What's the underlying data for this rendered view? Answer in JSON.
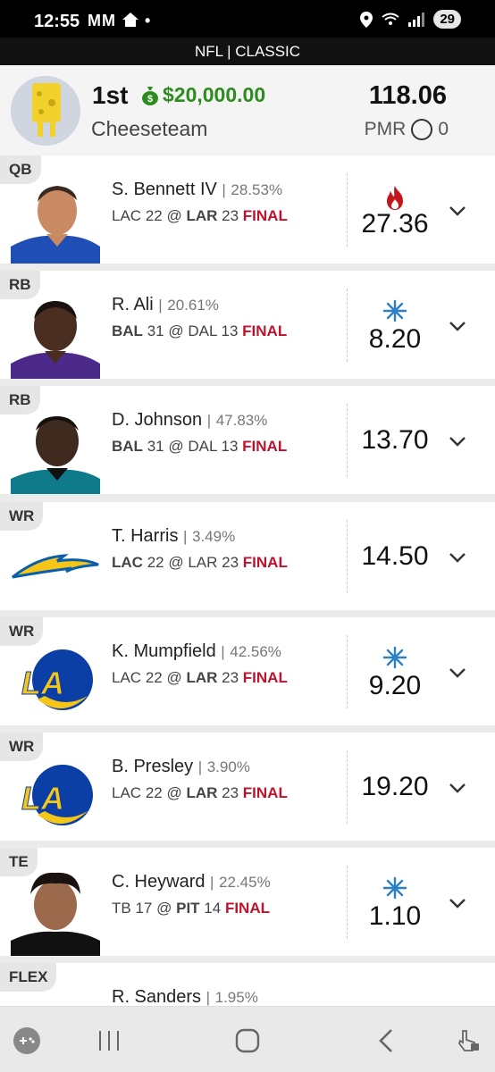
{
  "status_bar": {
    "time": "12:55",
    "left_icons": "MM",
    "battery": "29"
  },
  "header": {
    "title": "NFL | CLASSIC"
  },
  "summary": {
    "rank": "1st",
    "prize": "$20,000.00",
    "team_name": "Cheeseteam",
    "total_points": "118.06",
    "pmr_label": "PMR",
    "pmr_value": "0"
  },
  "players": [
    {
      "pos": "QB",
      "name": "S. Bennett IV",
      "pct": "28.53%",
      "away": "LAC",
      "away_score": "22",
      "home": "LAR",
      "home_score": "23",
      "bold": "home",
      "status": "FINAL",
      "points": "27.36",
      "indicator": "fire-icon",
      "thumb": "player-photo-ram"
    },
    {
      "pos": "RB",
      "name": "R. Ali",
      "pct": "20.61%",
      "away": "BAL",
      "away_score": "31",
      "home": "DAL",
      "home_score": "13",
      "bold": "away",
      "status": "FINAL",
      "points": "8.20",
      "indicator": "snowflake-icon",
      "thumb": "player-photo-raven"
    },
    {
      "pos": "RB",
      "name": "D. Johnson",
      "pct": "47.83%",
      "away": "BAL",
      "away_score": "31",
      "home": "DAL",
      "home_score": "13",
      "bold": "away",
      "status": "FINAL",
      "points": "13.70",
      "indicator": "",
      "thumb": "player-photo-jaguar"
    },
    {
      "pos": "WR",
      "name": "T. Harris",
      "pct": "3.49%",
      "away": "LAC",
      "away_score": "22",
      "home": "LAR",
      "home_score": "23",
      "bold": "away",
      "status": "FINAL",
      "points": "14.50",
      "indicator": "",
      "thumb": "chargers-logo"
    },
    {
      "pos": "WR",
      "name": "K. Mumpfield",
      "pct": "42.56%",
      "away": "LAC",
      "away_score": "22",
      "home": "LAR",
      "home_score": "23",
      "bold": "home",
      "status": "FINAL",
      "points": "9.20",
      "indicator": "snowflake-icon",
      "thumb": "rams-logo"
    },
    {
      "pos": "WR",
      "name": "B. Presley",
      "pct": "3.90%",
      "away": "LAC",
      "away_score": "22",
      "home": "LAR",
      "home_score": "23",
      "bold": "home",
      "status": "FINAL",
      "points": "19.20",
      "indicator": "",
      "thumb": "rams-logo"
    },
    {
      "pos": "TE",
      "name": "C. Heyward",
      "pct": "22.45%",
      "away": "TB",
      "away_score": "17",
      "home": "PIT",
      "home_score": "14",
      "bold": "home",
      "status": "FINAL",
      "points": "1.10",
      "indicator": "snowflake-icon",
      "thumb": "player-photo-steeler"
    },
    {
      "pos": "FLEX",
      "name": "R. Sanders",
      "pct": "1.95%",
      "away": "",
      "away_score": "",
      "home": "",
      "home_score": "",
      "bold": "",
      "status": "",
      "points": "",
      "indicator": "",
      "thumb": ""
    }
  ],
  "colors": {
    "final": "#c0122c",
    "prize": "#2e8b1f",
    "fire": "#c4161c",
    "snow": "#2b7fc4"
  }
}
